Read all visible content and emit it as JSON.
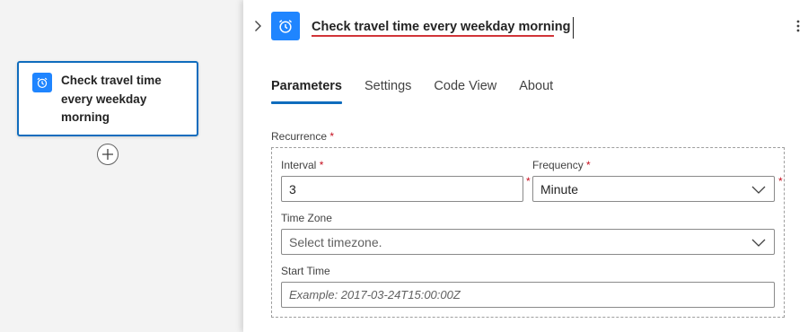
{
  "canvas": {
    "node_title": "Check travel time every weekday morning",
    "node_icon": "alarm-clock-icon",
    "add_icon": "plus-circle-icon"
  },
  "panel": {
    "title": "Check travel time every weekday morning",
    "header_icon": "alarm-clock-icon",
    "collapse_icon": "chevron-right-icon",
    "more_icon": "more-vertical-icon",
    "tabs": [
      {
        "label": "Parameters",
        "active": true
      },
      {
        "label": "Settings",
        "active": false
      },
      {
        "label": "Code View",
        "active": false
      },
      {
        "label": "About",
        "active": false
      }
    ],
    "recurrence_label": "Recurrence",
    "interval_label": "Interval",
    "interval_value": "3",
    "frequency_label": "Frequency",
    "frequency_value": "Minute",
    "timezone_label": "Time Zone",
    "timezone_placeholder": "Select timezone.",
    "start_time_label": "Start Time",
    "start_time_placeholder": "Example: 2017-03-24T15:00:00Z",
    "required_marker": "*"
  },
  "colors": {
    "accent": "#0f6cbd",
    "icon_bg": "#1f85ff",
    "required": "#c50f1f",
    "spell_underline": "#d13438"
  }
}
